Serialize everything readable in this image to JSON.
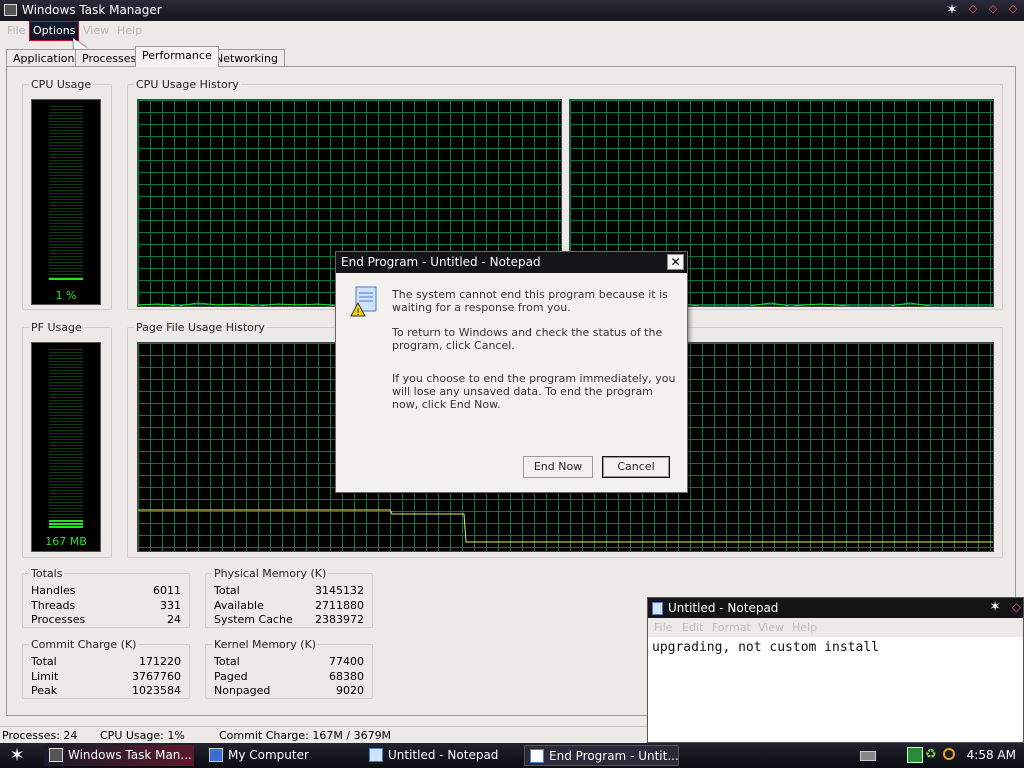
{
  "window": {
    "title": "Windows Task Manager"
  },
  "menu": {
    "file": "File",
    "options": "Options",
    "view": "View",
    "help": "Help"
  },
  "tabs": [
    "Applications",
    "Processes",
    "Performance",
    "Networking"
  ],
  "panels": {
    "cpu_usage": "CPU Usage",
    "cpu_history": "CPU Usage History",
    "pf_usage": "PF Usage",
    "pf_history": "Page File Usage History",
    "cpu_value": "1 %",
    "pf_value": "167 MB",
    "cpu_fraction": 0.01,
    "pf_fraction": 0.05
  },
  "totals": {
    "label": "Totals",
    "rows": [
      {
        "name": "Handles",
        "value": "6011"
      },
      {
        "name": "Threads",
        "value": "331"
      },
      {
        "name": "Processes",
        "value": "24"
      }
    ]
  },
  "physical_memory": {
    "label": "Physical Memory (K)",
    "rows": [
      {
        "name": "Total",
        "value": "3145132"
      },
      {
        "name": "Available",
        "value": "2711880"
      },
      {
        "name": "System Cache",
        "value": "2383972"
      }
    ]
  },
  "commit_charge": {
    "label": "Commit Charge (K)",
    "rows": [
      {
        "name": "Total",
        "value": "171220"
      },
      {
        "name": "Limit",
        "value": "3767760"
      },
      {
        "name": "Peak",
        "value": "1023584"
      }
    ]
  },
  "kernel_memory": {
    "label": "Kernel Memory (K)",
    "rows": [
      {
        "name": "Total",
        "value": "77400"
      },
      {
        "name": "Paged",
        "value": "68380"
      },
      {
        "name": "Nonpaged",
        "value": "9020"
      }
    ]
  },
  "statusbar": {
    "processes": "Processes: 24",
    "cpu": "CPU Usage: 1%",
    "commit": "Commit Charge: 167M / 3679M"
  },
  "dialog": {
    "title": "End Program - Untitled - Notepad",
    "message1": "The system cannot end this program because it is waiting for a response from you.",
    "message2": "To return to Windows and check the status of the program, click Cancel.",
    "message3": "If you choose to end the program immediately, you will lose any unsaved data. To end the program now, click End Now.",
    "end_now": "End Now",
    "cancel": "Cancel",
    "close_glyph": "✕"
  },
  "notepad": {
    "title": "Untitled - Notepad",
    "menu": [
      "File",
      "Edit",
      "Format",
      "View",
      "Help"
    ],
    "content": "upgrading, not custom install"
  },
  "taskbar": {
    "start_glyph": "✶",
    "buttons": [
      {
        "label": "Windows Task Man..."
      },
      {
        "label": "My Computer"
      },
      {
        "label": "Untitled - Notepad"
      },
      {
        "label": "End Program - Untit..."
      }
    ],
    "clock": "4:58 AM"
  },
  "titlebar_glyphs": {
    "star": "✶",
    "minimize": "◇",
    "maximize": "◇",
    "close": "◇"
  }
}
